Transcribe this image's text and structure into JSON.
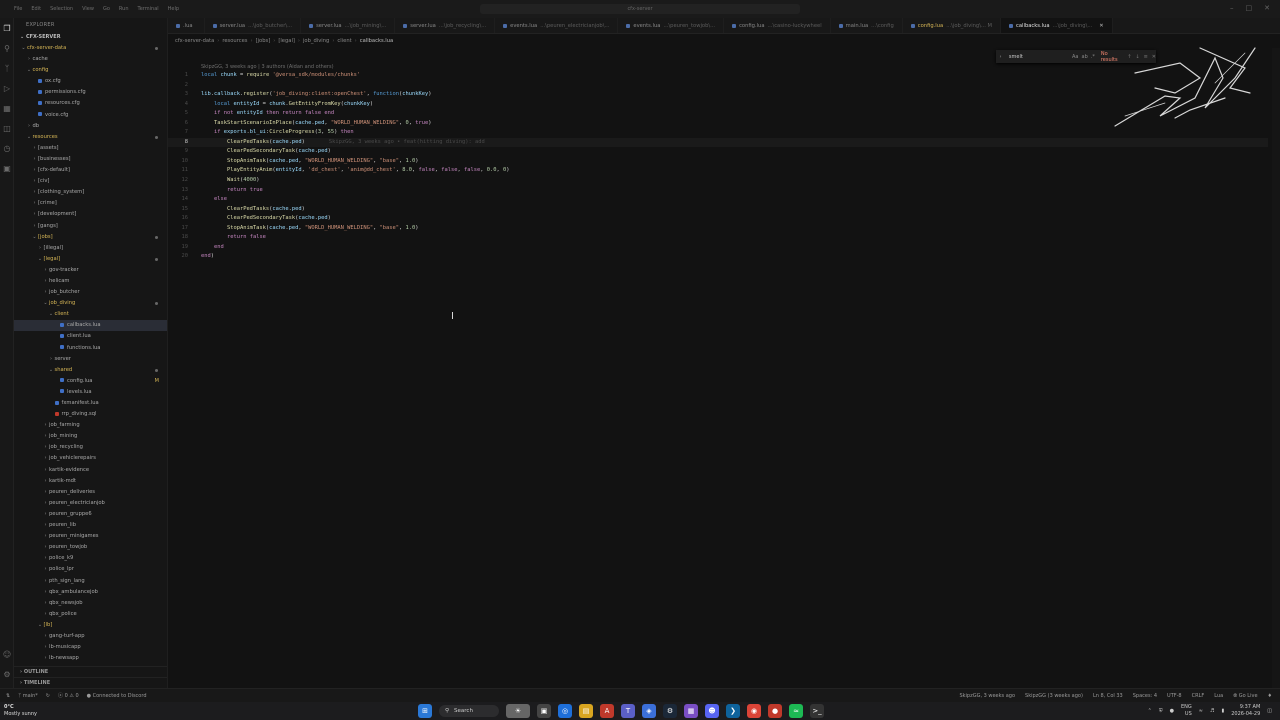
{
  "titlebar": {
    "menu": [
      "File",
      "Edit",
      "Selection",
      "View",
      "Go",
      "Run",
      "Terminal",
      "Help"
    ],
    "command_center": "cfx-server"
  },
  "sidebar": {
    "header": "EXPLORER",
    "root": "CFX-SERVER",
    "tree": [
      {
        "label": "cfx-server-data",
        "depth": 0,
        "kind": "folder-open",
        "dot": true
      },
      {
        "label": "cache",
        "depth": 1,
        "kind": "folder"
      },
      {
        "label": "config",
        "depth": 1,
        "kind": "folder-open"
      },
      {
        "label": "ox.cfg",
        "depth": 2,
        "kind": "file"
      },
      {
        "label": "permissions.cfg",
        "depth": 2,
        "kind": "file"
      },
      {
        "label": "resources.cfg",
        "depth": 2,
        "kind": "file"
      },
      {
        "label": "voice.cfg",
        "depth": 2,
        "kind": "file"
      },
      {
        "label": "db",
        "depth": 1,
        "kind": "folder"
      },
      {
        "label": "resources",
        "depth": 1,
        "kind": "folder-open",
        "dot": true
      },
      {
        "label": "[assets]",
        "depth": 2,
        "kind": "folder"
      },
      {
        "label": "[businesses]",
        "depth": 2,
        "kind": "folder"
      },
      {
        "label": "[cfx-default]",
        "depth": 2,
        "kind": "folder"
      },
      {
        "label": "[civ]",
        "depth": 2,
        "kind": "folder"
      },
      {
        "label": "[clothing_system]",
        "depth": 2,
        "kind": "folder"
      },
      {
        "label": "[crime]",
        "depth": 2,
        "kind": "folder"
      },
      {
        "label": "[development]",
        "depth": 2,
        "kind": "folder"
      },
      {
        "label": "[gangs]",
        "depth": 2,
        "kind": "folder"
      },
      {
        "label": "[jobs]",
        "depth": 2,
        "kind": "folder-open",
        "dot": true
      },
      {
        "label": "[illegal]",
        "depth": 3,
        "kind": "folder"
      },
      {
        "label": "[legal]",
        "depth": 3,
        "kind": "folder-open",
        "dot": true
      },
      {
        "label": "gov-tracker",
        "depth": 4,
        "kind": "folder"
      },
      {
        "label": "helicam",
        "depth": 4,
        "kind": "folder"
      },
      {
        "label": "job_butcher",
        "depth": 4,
        "kind": "folder"
      },
      {
        "label": "job_diving",
        "depth": 4,
        "kind": "folder-open",
        "dot": true
      },
      {
        "label": "client",
        "depth": 5,
        "kind": "folder-open"
      },
      {
        "label": "callbacks.lua",
        "depth": 6,
        "kind": "file",
        "selected": true
      },
      {
        "label": "client.lua",
        "depth": 6,
        "kind": "file"
      },
      {
        "label": "functions.lua",
        "depth": 6,
        "kind": "file"
      },
      {
        "label": "server",
        "depth": 5,
        "kind": "folder"
      },
      {
        "label": "shared",
        "depth": 5,
        "kind": "folder-open",
        "dot": true
      },
      {
        "label": "config.lua",
        "depth": 6,
        "kind": "file",
        "modified": "M"
      },
      {
        "label": "levels.lua",
        "depth": 6,
        "kind": "file"
      },
      {
        "label": "fxmanifest.lua",
        "depth": 5,
        "kind": "file"
      },
      {
        "label": "rrp_diving.sql",
        "depth": 5,
        "kind": "sql"
      },
      {
        "label": "job_farming",
        "depth": 4,
        "kind": "folder"
      },
      {
        "label": "job_mining",
        "depth": 4,
        "kind": "folder"
      },
      {
        "label": "job_recycling",
        "depth": 4,
        "kind": "folder"
      },
      {
        "label": "job_vehiclerepairs",
        "depth": 4,
        "kind": "folder"
      },
      {
        "label": "kartik-evidence",
        "depth": 4,
        "kind": "folder"
      },
      {
        "label": "kartik-mdt",
        "depth": 4,
        "kind": "folder"
      },
      {
        "label": "peuren_deliveries",
        "depth": 4,
        "kind": "folder"
      },
      {
        "label": "peuren_electricianjob",
        "depth": 4,
        "kind": "folder"
      },
      {
        "label": "peuren_gruppe6",
        "depth": 4,
        "kind": "folder"
      },
      {
        "label": "peuren_lib",
        "depth": 4,
        "kind": "folder"
      },
      {
        "label": "peuren_minigames",
        "depth": 4,
        "kind": "folder"
      },
      {
        "label": "peuren_towjob",
        "depth": 4,
        "kind": "folder"
      },
      {
        "label": "police_k9",
        "depth": 4,
        "kind": "folder"
      },
      {
        "label": "police_lpr",
        "depth": 4,
        "kind": "folder"
      },
      {
        "label": "pth_sign_lang",
        "depth": 4,
        "kind": "folder"
      },
      {
        "label": "qbx_ambulancejob",
        "depth": 4,
        "kind": "folder"
      },
      {
        "label": "qbx_newsjob",
        "depth": 4,
        "kind": "folder"
      },
      {
        "label": "qbx_police",
        "depth": 4,
        "kind": "folder"
      },
      {
        "label": "[lb]",
        "depth": 3,
        "kind": "folder-open"
      },
      {
        "label": "gang-turf-app",
        "depth": 4,
        "kind": "folder"
      },
      {
        "label": "lb-musicapp",
        "depth": 4,
        "kind": "folder"
      },
      {
        "label": "lb-newsapp",
        "depth": 4,
        "kind": "folder"
      }
    ],
    "outline": "OUTLINE",
    "timeline": "TIMELINE"
  },
  "tabs": [
    {
      "name": ".lua",
      "path": ""
    },
    {
      "name": "server.lua",
      "path": "...\\job_butcher\\..."
    },
    {
      "name": "server.lua",
      "path": "...\\job_mining\\..."
    },
    {
      "name": "server.lua",
      "path": "...\\job_recycling\\..."
    },
    {
      "name": "events.lua",
      "path": "...\\peuren_electricianjob\\..."
    },
    {
      "name": "events.lua",
      "path": "...\\peuren_towjob\\..."
    },
    {
      "name": "config.lua",
      "path": "...\\casino-luckywheel"
    },
    {
      "name": "main.lua",
      "path": "...\\config"
    },
    {
      "name": "config.lua",
      "path": "...\\job_diving\\... M",
      "modified": true
    },
    {
      "name": "callbacks.lua",
      "path": "...\\job_diving\\...",
      "active": true
    }
  ],
  "breadcrumb": [
    "cfx-server-data",
    "resources",
    "[jobs]",
    "[legal]",
    "job_diving",
    "client",
    "callbacks.lua"
  ],
  "find_widget": {
    "value": "smelt",
    "options": [
      "Aa",
      "ab",
      ".*"
    ],
    "result": "No results"
  },
  "editor": {
    "blame_header": "SkipzGG, 3 weeks ago | 3 authors (Aidan and others)",
    "current_line": 8,
    "inline_blame": "SkipzGG, 3 weeks ago • feat(hitting diving): add",
    "lines": [
      "local chunk = require '@versa_sdk/modules/chunks'",
      "",
      "lib.callback.register('job_diving:client:openChest', function(chunkKey)",
      "    local entityId = chunk.GetEntityFromKey(chunkKey)",
      "    if not entityId then return false end",
      "    TaskStartScenarioInPlace(cache.ped, \"WORLD_HUMAN_WELDING\", 0, true)",
      "    if exports.bl_ui:CircleProgress(3, 55) then",
      "        ClearPedTasks(cache.ped)",
      "        ClearPedSecondaryTask(cache.ped)",
      "        StopAnimTask(cache.ped, \"WORLD_HUMAN_WELDING\", \"base\", 1.0)",
      "        PlayEntityAnim(entityId, 'dd_chest', 'anim@dd_chest', 8.0, false, false, false, 0.0, 0)",
      "        Wait(4000)",
      "        return true",
      "    else",
      "        ClearPedTasks(cache.ped)",
      "        ClearPedSecondaryTask(cache.ped)",
      "        StopAnimTask(cache.ped, \"WORLD_HUMAN_WELDING\", \"base\", 1.0)",
      "        return false",
      "    end",
      "end)"
    ]
  },
  "statusbar": {
    "branch": "main*",
    "errors": "0",
    "warnings": "0",
    "discord": "Connected to Discord",
    "blame1": "SkipzGG, 3 weeks ago",
    "blame2": "SkipzGG (3 weeks ago)",
    "position": "Ln 8, Col 33",
    "spaces": "Spaces: 4",
    "encoding": "UTF-8",
    "eol": "CRLF",
    "language": "Lua",
    "golive": "Go Live"
  },
  "taskbar": {
    "temp": "0°C",
    "weather": "Mostly sunny",
    "search": "Search",
    "lang1": "ENG",
    "lang2": "US",
    "time": "9:37 AM",
    "date": "2026-04-29"
  },
  "colors": {
    "accent": "#d6b656",
    "find_no_results": "#f48771",
    "selection": "#2a2d36"
  }
}
